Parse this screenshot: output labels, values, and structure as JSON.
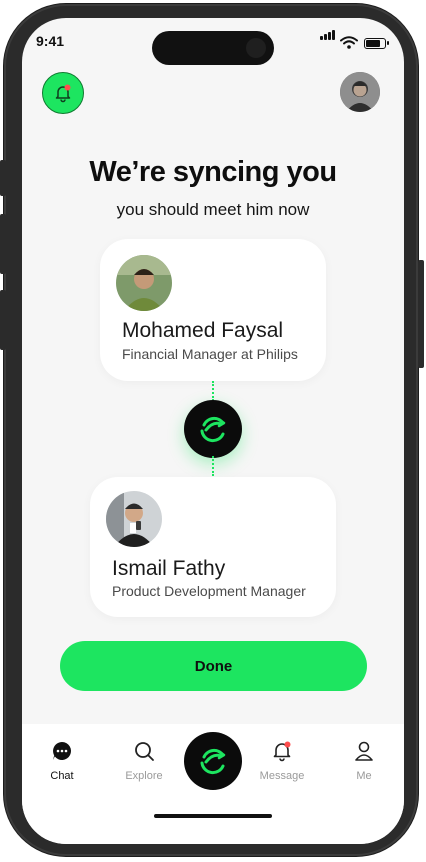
{
  "status_bar": {
    "time": "9:41",
    "battery_level": 0.85
  },
  "header": {
    "notification_icon": "bell-icon",
    "avatar_icon": "user-avatar"
  },
  "heading": {
    "title": "We’re syncing you",
    "subtitle": "you should meet him now"
  },
  "matches": [
    {
      "name": "Mohamed Faysal",
      "role": "Financial Manager at Philips"
    },
    {
      "name": "Ismail Fathy",
      "role": "Product Development Manager"
    }
  ],
  "sync_icon": "sync-logo-icon",
  "actions": {
    "done_label": "Done"
  },
  "tabbar": {
    "items": [
      {
        "label": "Chat",
        "icon": "chat-icon",
        "active": true
      },
      {
        "label": "Explore",
        "icon": "search-icon",
        "active": false
      },
      {
        "label": "Message",
        "icon": "bell-icon",
        "active": false
      },
      {
        "label": "Me",
        "icon": "user-icon",
        "active": false
      }
    ],
    "center_icon": "sync-logo-icon"
  },
  "colors": {
    "accent": "#1de560",
    "dark": "#0b0b0b",
    "background": "#f6f6f6",
    "badge": "#ff4d4d"
  }
}
